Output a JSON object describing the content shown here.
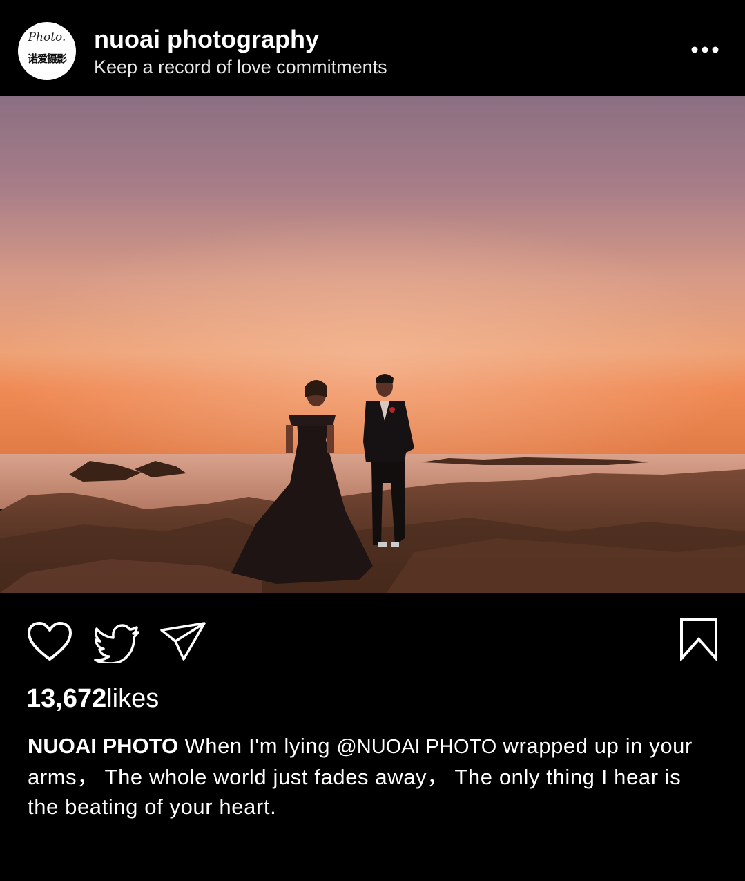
{
  "header": {
    "avatar": {
      "script": "Photo.",
      "cn": "诺爱摄影"
    },
    "title": "nuoai photography",
    "subtitle": "Keep a record of love commitments",
    "more_icon": "more-horizontal-icon"
  },
  "post": {
    "image_alt_icon": "photo",
    "actions": {
      "like_icon": "heart-icon",
      "share_twitter_icon": "twitter-bird-icon",
      "send_icon": "paper-plane-icon",
      "bookmark_icon": "bookmark-icon"
    },
    "likes_count": "13,672",
    "likes_label": "likes",
    "caption": {
      "username": "NUOAI PHOTO",
      "text_part1": " When I'm lying ",
      "mention": "@NUOAI PHOTO",
      "text_part2": " wrapped up in your arms， The whole world just fades away， The only thing I hear is the beating of your heart."
    }
  },
  "colors": {
    "background": "#000000",
    "text": "#ffffff"
  }
}
